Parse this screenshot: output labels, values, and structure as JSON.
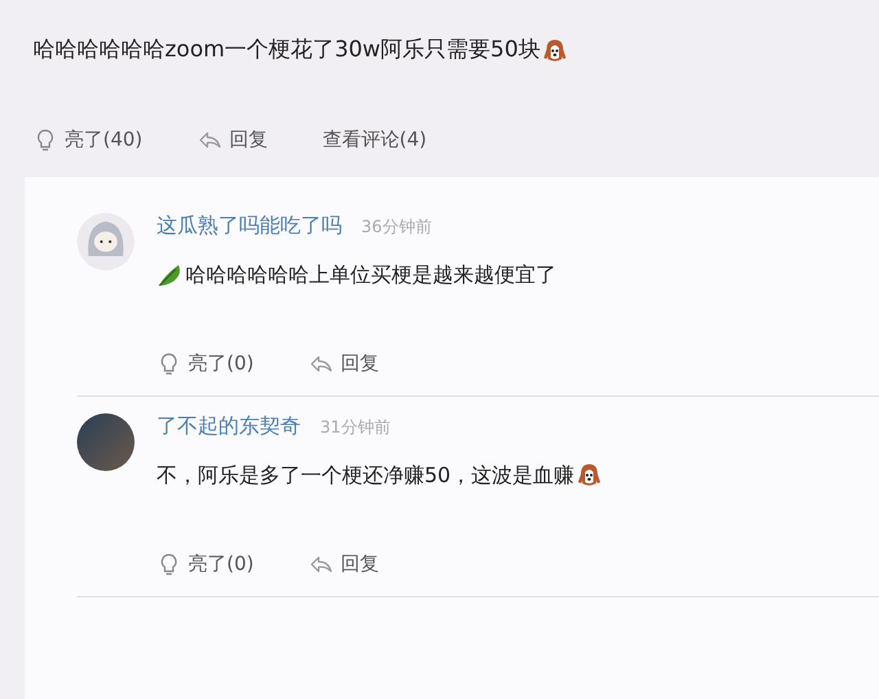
{
  "comment": {
    "body": [
      {
        "kind": "text",
        "text": "哈哈哈哈哈哈zoom一个梗花了30w阿乐只需要50块"
      },
      {
        "kind": "dog"
      }
    ],
    "actions": {
      "like": "亮了(40)",
      "reply": "回复",
      "view": "查看评论(4)"
    }
  },
  "replies": [
    {
      "kind": "cartoon",
      "name": "这瓜熟了吗能吃了吗",
      "time": "36分钟前",
      "body": [
        {
          "kind": "leaf"
        },
        {
          "kind": "text",
          "text": "哈哈哈哈哈哈上单位买梗是越来越便宜了"
        }
      ],
      "like": "亮了(0)",
      "reply": "回复"
    },
    {
      "kind": "photo",
      "name": "了不起的东契奇",
      "time": "31分钟前",
      "body": [
        {
          "kind": "text",
          "text": "不，阿乐是多了一个梗还净赚50，这波是血赚"
        },
        {
          "kind": "dog"
        }
      ],
      "like": "亮了(0)",
      "reply": "回复"
    }
  ]
}
